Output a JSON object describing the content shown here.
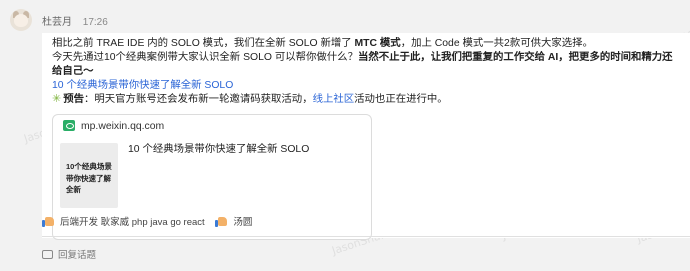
{
  "author": {
    "name": "杜芸月",
    "time": "17:26"
  },
  "post": {
    "line1_a": "相比之前 TRAE IDE 内的 SOLO 模式，我们在全新 SOLO 新增了 ",
    "line1_b": "MTC 模式",
    "line1_c": "，加上 Code 模式一共2款可供大家选择。",
    "line2_a": "今天先通过10个经典案例带大家认识全新 SOLO 可以帮你做什么？",
    "line2_b": "当然不止于此，让我们把重复的工作交给 AI，把更多的时间和精力还给自己～",
    "line3_link": "10 个经典场景带你快速了解全新 SOLO",
    "notice_label": "预告",
    "notice_text_a": "：明天官方账号还会发布新一轮邀请码获取活动，",
    "notice_link": "线上社区",
    "notice_text_b": "活动也正在进行中。"
  },
  "card": {
    "host": "mp.weixin.qq.com",
    "title": "10 个经典场景带你快速了解全新 SOLO",
    "thumb_line1": "10个经典场景",
    "thumb_line2": "带你快速了解全新",
    "thumb_line3": "："
  },
  "reactions": [
    {
      "label": "后端开发 耿家威 php java go react"
    },
    {
      "label": "汤圆"
    }
  ],
  "reply": {
    "label": "回复话题"
  },
  "watermark": "JasonShane 3075"
}
